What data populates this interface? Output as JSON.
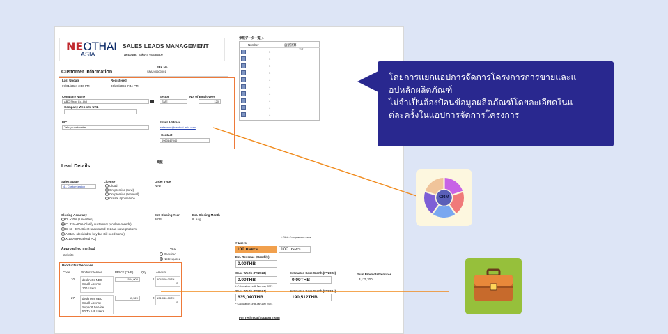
{
  "header": {
    "logo_neo": "NE",
    "logo_o": "O",
    "logo_thai": "THAI",
    "logo_asia": "ASIA",
    "title": "SALES LEADS MANAGEMENT",
    "account_label": "Account",
    "account_value": "Takuya Watanabe",
    "sfa_label": "SFA No.",
    "sfa_value": "SFA240600001"
  },
  "customer": {
    "section_title": "Customer Information",
    "last_update_label": "Last Update",
    "last_update_value": "07/01/2024 3:30 PM",
    "registered_label": "Registered",
    "registered_value": "06/28/2024 7:44 PM",
    "company_name_label": "Company Name",
    "company_name_value": "ABC Shop Co.,Ltd",
    "sector_label": "Sector",
    "sector_value": "SME",
    "employees_label": "No. of Employees",
    "employees_value": "120",
    "website_label": "Company Web site URL",
    "website_value": "",
    "pic_label": "PIC",
    "pic_value": "Takuya watanabe",
    "email_label": "Email Address",
    "email_value": "watanabe@neothai-asia.com",
    "contact_label": "Contact",
    "contact_value": "0960847040"
  },
  "reference": {
    "title": "参照データ一覧_1",
    "col_number": "Number",
    "col_auto": "自動計算",
    "auto_value": "117",
    "rows": [
      "1",
      "1",
      "1",
      "1",
      "1",
      "1",
      "1",
      "1",
      "1",
      "1"
    ]
  },
  "lead": {
    "section_title": "Lead Details",
    "mark": "商談",
    "sales_stage_label": "Sales Stage",
    "sales_stage_value": "4 - Customization",
    "license_label": "License",
    "license_options": [
      "Cloud",
      "On-premise (new)",
      "On-premise (renewal)",
      "Create app service"
    ],
    "license_selected": 1,
    "order_type_label": "Order Type",
    "order_type_value": "New",
    "closing_accuracy_label": "Closing Accuracy",
    "closing_options": [
      "D: ~30% (Uncertain)",
      "C: 31%~60%(Clarify customers problem&needs)",
      "B: 61~80%(Client understand DN can solve problem)",
      "A:81%~(decided to buy but still need some)",
      "X:100%(Received PO)"
    ],
    "closing_selected": 1,
    "closing_year_label": "Est. Closing Year",
    "closing_year_value": "2024",
    "closing_month_label": "Est. Closing Month",
    "closing_month_value": "8. Aug",
    "approached_label": "Approached method",
    "approached_value": "Website",
    "trial_label": "Trial",
    "trial_options": [
      "Required",
      "Not required"
    ],
    "trial_selected": 1,
    "onprem_note": "* Fill in if on-premise case"
  },
  "users": {
    "label": "# Users",
    "value1": "100 users",
    "value2": "100 users",
    "revenue_label": "Est. Revenue (Monthly)",
    "revenue_value": "0.00THB",
    "case_worth_label": "Case Worth (FY2023)",
    "case_worth_value": "0.00THB",
    "est_case_worth_label": "Estimated Case Worth (FY2023)",
    "est_case_worth_value": "0.00THB",
    "sum_label": "Sum Products/Services",
    "sum_value": "3,175,200...",
    "calc_note_2023": "* Calculation until January 2023",
    "case_worth_2024_label": "Case Worth (FY2024)",
    "case_worth_2024_value": "635,040THB",
    "est_case_worth_2024_label": "Estimated Case Worth (FY2024)",
    "est_case_worth_2024_value": "190,512THB",
    "calc_note_2024": "* Calculation until January 2024",
    "support_team": "For Technical/Support Team"
  },
  "products": {
    "section_title": "Products / Services",
    "headers": [
      "Code",
      "Product/Service",
      "PRICE (THB)",
      "Qty",
      "Amount"
    ],
    "rows": [
      {
        "code": "10",
        "name1": "desknet's NEO",
        "name2": "Small License",
        "name3": "100 Users",
        "name4": "",
        "price": "504,000",
        "qty": "1",
        "amount1": "504,000.00TH",
        "amount2": "B"
      },
      {
        "code": "27",
        "name1": "desknet's NEO",
        "name2": "Small License",
        "name3": "Support Service",
        "name4": "50 To 149 Users",
        "price": "65,520",
        "qty": "2",
        "amount1": "131,040.00TH",
        "amount2": "B"
      }
    ]
  },
  "callout": {
    "line1": "โดยการแยกแอปการจัดการโครงการการขายและแ",
    "line2": "อปหลักผลิตภัณฑ์",
    "line3": "ไม่จำเป็นต้องป้อนข้อมูลผลิตภัณฑ์โดยละเอียดในแ",
    "line4": "ต่ละครั้งในแอปการจัดการโครงการ"
  },
  "crm": {
    "label": "CRM"
  },
  "colors": {
    "background": "#dde5f6",
    "callout": "#29288f",
    "orange": "#ee7a3a",
    "crm_card": "#fdf7df",
    "brief_card": "#96c03b"
  },
  "icons": [
    "crm-wheel-icon",
    "briefcase-icon",
    "window-icon",
    "link-icon"
  ]
}
